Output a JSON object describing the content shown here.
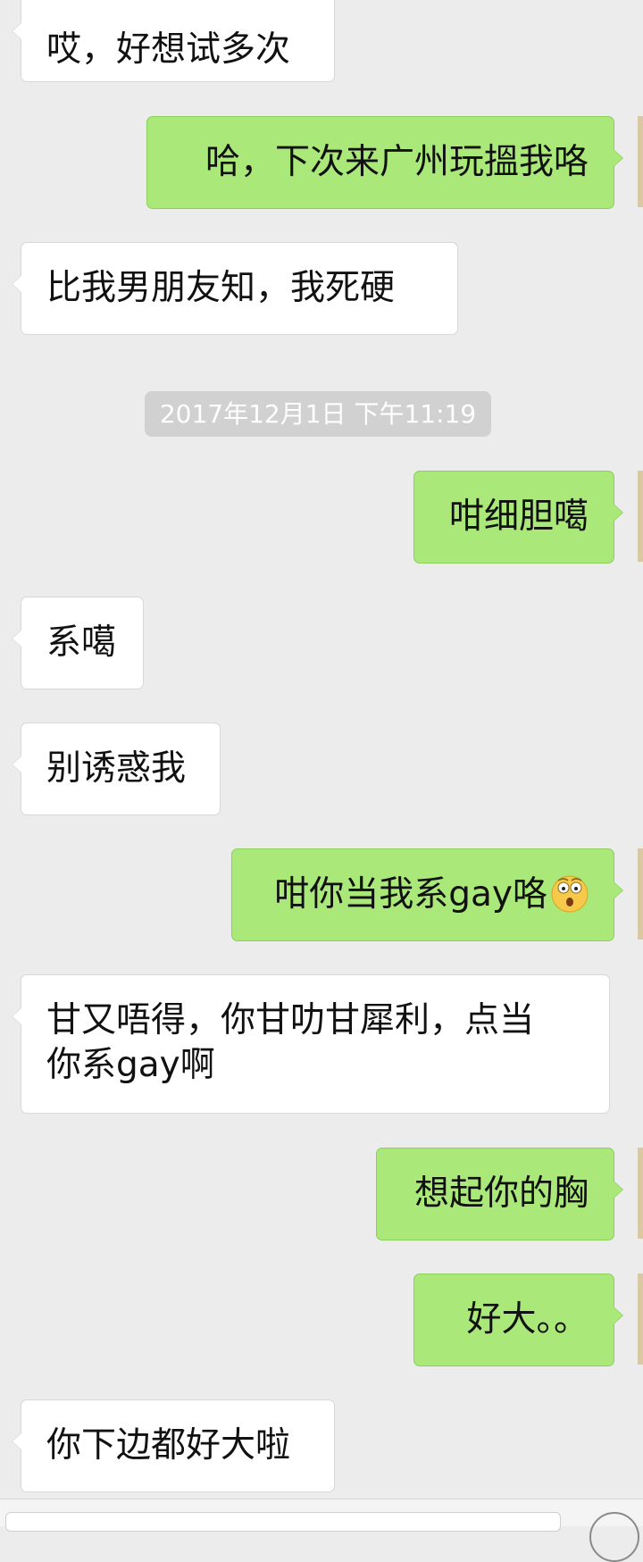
{
  "messages": [
    {
      "side": "in",
      "text": "哎，好想试多次"
    },
    {
      "side": "out",
      "text": "哈，下次来广州玩搵我咯"
    },
    {
      "side": "in",
      "text": "比我男朋友知，我死硬"
    },
    {
      "side": "out",
      "text": "咁细胆噶"
    },
    {
      "side": "in",
      "text": "系噶"
    },
    {
      "side": "in",
      "text": "别诱惑我"
    },
    {
      "side": "out",
      "text": "咁你当我系gay咯",
      "emoji": "shocked-face-emoji"
    },
    {
      "side": "in",
      "text_line1": "甘又唔得，你甘叻甘犀利，点当",
      "text_line2": "你系gay啊"
    },
    {
      "side": "out",
      "text": "想起你的胸"
    },
    {
      "side": "out",
      "text": "好大。。"
    },
    {
      "side": "in",
      "text": "你下边都好大啦"
    }
  ],
  "timestamp": "2017年12月1日  下午11:19",
  "colors": {
    "background": "#ececec",
    "incoming_bubble": "#ffffff",
    "outgoing_bubble": "#a9e879",
    "timestamp_bg": "#d1d1d1"
  }
}
